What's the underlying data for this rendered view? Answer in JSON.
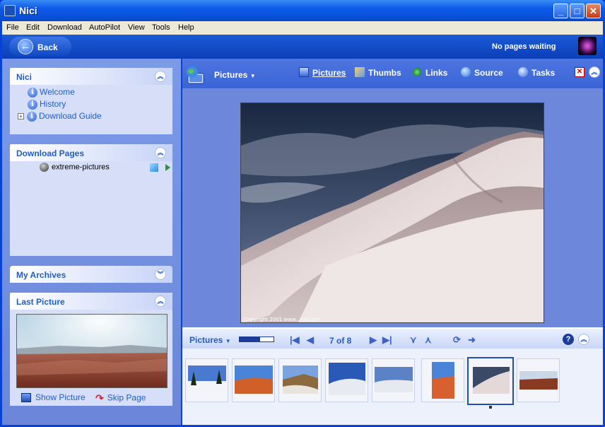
{
  "window": {
    "title": "Nici",
    "minimize": "_",
    "maximize": "□",
    "close": "✕"
  },
  "menu": [
    "File",
    "Edit",
    "Download",
    "AutoPilot",
    "View",
    "Tools",
    "Help"
  ],
  "navbar": {
    "back_label": "Back",
    "status": "No pages waiting"
  },
  "panels": {
    "nici": {
      "title": "Nici",
      "items": [
        "Welcome",
        "History",
        "Download Guide"
      ]
    },
    "download_pages": {
      "title": "Download Pages",
      "items": [
        "extreme-pictures"
      ]
    },
    "my_archives": {
      "title": "My Archives"
    },
    "last_picture": {
      "title": "Last Picture",
      "show_picture": "Show Picture",
      "skip_page": "Skip Page"
    }
  },
  "toolbar": {
    "dropdown": "Pictures",
    "tabs": [
      "Pictures",
      "Thumbs",
      "Links",
      "Source",
      "Tasks"
    ]
  },
  "main_picture": {
    "caption": "Copyright 2001 www...tos.com"
  },
  "filmstrip": {
    "label": "Pictures",
    "progress_fraction": 0.6,
    "counter": "7 of 8",
    "selected_index": 6,
    "thumb_count": 8
  },
  "colors": {
    "titlebar": "#0c5ae8",
    "pane_bg": "#6d87db",
    "panel_title": "#215dc6",
    "film_bg": "#edf1fc"
  },
  "icons": {
    "globe": "globe-monitor-icon",
    "pictures_tab": "picture-icon",
    "thumbs_tab": "thumbs-icon",
    "links_tab": "links-icon",
    "source_tab": "source-icon",
    "tasks_tab": "info-icon"
  }
}
